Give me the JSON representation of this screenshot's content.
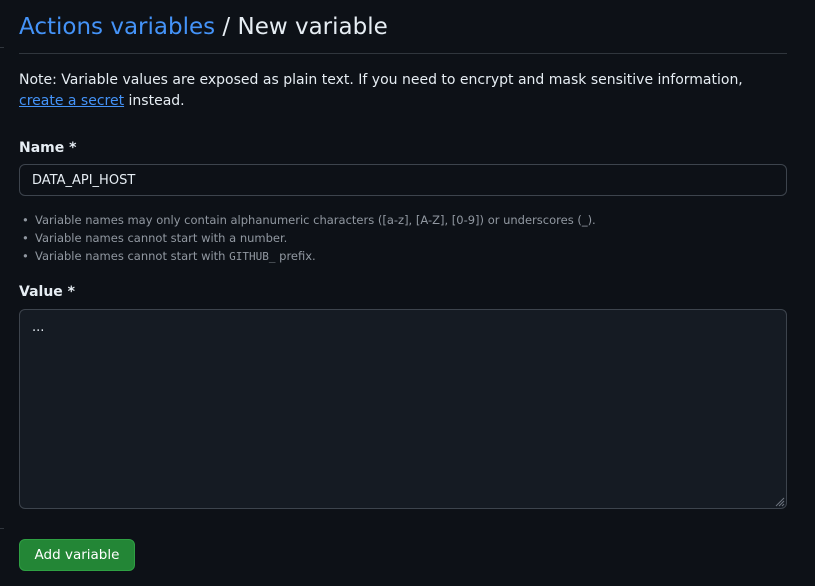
{
  "header": {
    "breadcrumb_link": "Actions variables",
    "separator": " / ",
    "current": "New variable"
  },
  "note": {
    "before": "Note: Variable values are exposed as plain text. If you need to encrypt and mask sensitive information, ",
    "link": "create a secret",
    "after": " instead."
  },
  "form": {
    "name_label": "Name *",
    "name_value": "DATA_API_HOST",
    "rules": {
      "rule1": "Variable names may only contain alphanumeric characters ([a-z], [A-Z], [0-9]) or underscores (_).",
      "rule2": "Variable names cannot start with a number.",
      "rule3_before": "Variable names cannot start with ",
      "rule3_code": "GITHUB_",
      "rule3_after": " prefix."
    },
    "value_label": "Value *",
    "value_text": "...",
    "submit_label": "Add variable"
  },
  "colors": {
    "background": "#0d1117",
    "link": "#4493f8",
    "primary_button": "#238636",
    "border": "#30363d",
    "muted_text": "#9198a1"
  },
  "icons": {
    "resize_handle": "textarea-resize-grip-icon",
    "rule_bullet": "bullet-dot-icon"
  }
}
